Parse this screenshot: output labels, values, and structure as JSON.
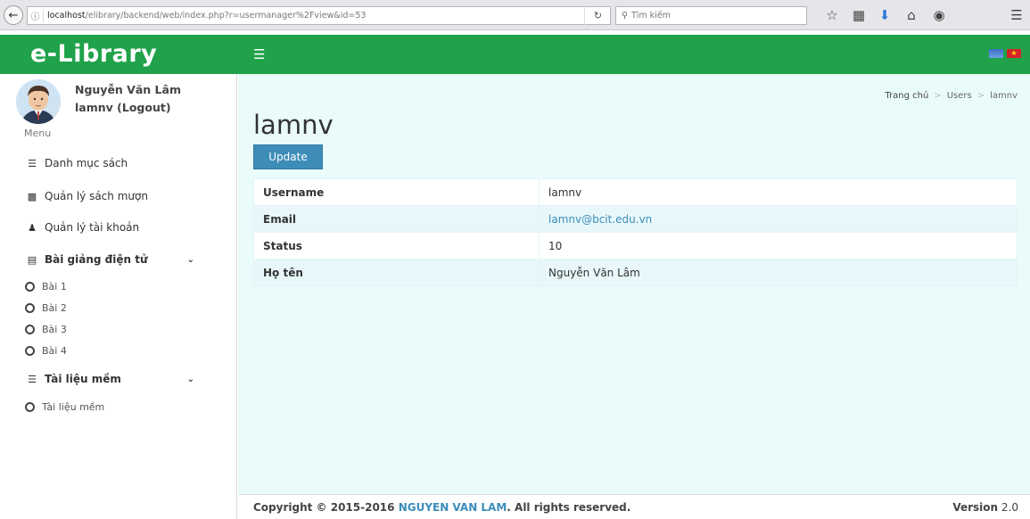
{
  "browser": {
    "url_host": "localhost",
    "url_path": "/elibrary/backend/web/index.php?r=usermanager%2Fview&id=53",
    "search_placeholder": "Tìm kiếm"
  },
  "header": {
    "logo": "e-Library",
    "accent_color": "#1fa24a"
  },
  "user": {
    "full_name": "Nguyễn Văn Lâm",
    "login_text": "lamnv (Logout)"
  },
  "sidebar": {
    "menu_header": "Menu",
    "items": [
      {
        "label": "Danh mục sách",
        "icon": "list-icon"
      },
      {
        "label": "Quản lý sách mượn",
        "icon": "book-icon"
      },
      {
        "label": "Quản lý tài khoản",
        "icon": "user-icon"
      },
      {
        "label": "Bài giảng điện tử",
        "icon": "file-icon"
      },
      {
        "label": "Tài liệu mềm",
        "icon": "list-icon"
      }
    ],
    "lectures": [
      "Bài 1",
      "Bài 2",
      "Bài 3",
      "Bài 4"
    ],
    "softdocs": [
      "Tài liệu mềm"
    ]
  },
  "breadcrumb": {
    "home": "Trang chủ",
    "users": "Users",
    "current": "lamnv"
  },
  "main": {
    "title": "lamnv",
    "update_label": "Update",
    "details": [
      {
        "label": "Username",
        "value": "lamnv"
      },
      {
        "label": "Email",
        "value": "lamnv@bcit.edu.vn"
      },
      {
        "label": "Status",
        "value": "10"
      },
      {
        "label": "Họ tên",
        "value": "Nguyễn Văn Lâm"
      }
    ]
  },
  "footer": {
    "copyright_prefix": "Copyright © 2015-2016 ",
    "author": "NGUYEN VAN LAM",
    "copyright_suffix": ". All rights reserved.",
    "version_label": "Version",
    "version_number": "2.0"
  }
}
